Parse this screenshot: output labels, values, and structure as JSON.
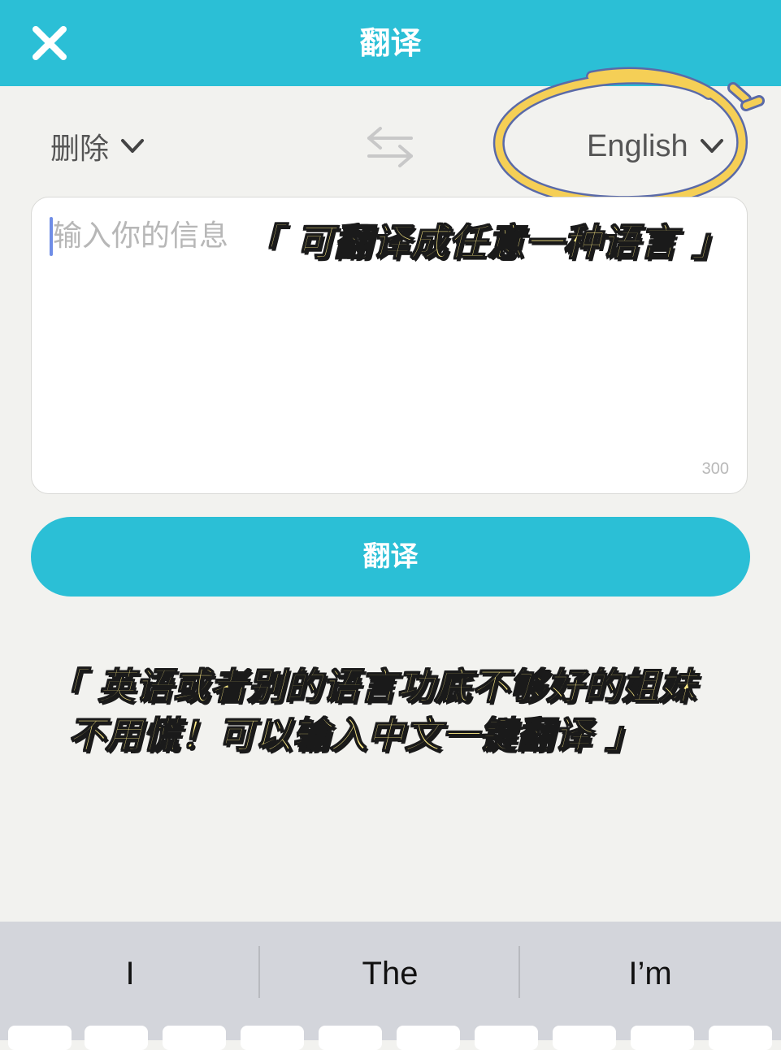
{
  "header": {
    "title": "翻译",
    "close_icon": "close-icon"
  },
  "language_bar": {
    "source_label": "删除",
    "target_label": "English",
    "swap_icon": "swap-arrows-icon"
  },
  "input": {
    "placeholder": "输入你的信息",
    "char_limit": "300"
  },
  "translate_button": {
    "label": "翻译"
  },
  "annotations": {
    "line1": "「 可翻译成任意一种语言 」",
    "line2": "「 英语或者别的语言功底不够好的姐妹",
    "line3": "不用慌！可以输入中文一键翻译 」"
  },
  "keyboard": {
    "suggestions": [
      "I",
      "The",
      "I’m"
    ]
  },
  "colors": {
    "accent": "#2bbfd6",
    "background": "#f2f2ef",
    "highlight_circle": "#f5cf56",
    "annotation_text": "#fdeb86"
  }
}
